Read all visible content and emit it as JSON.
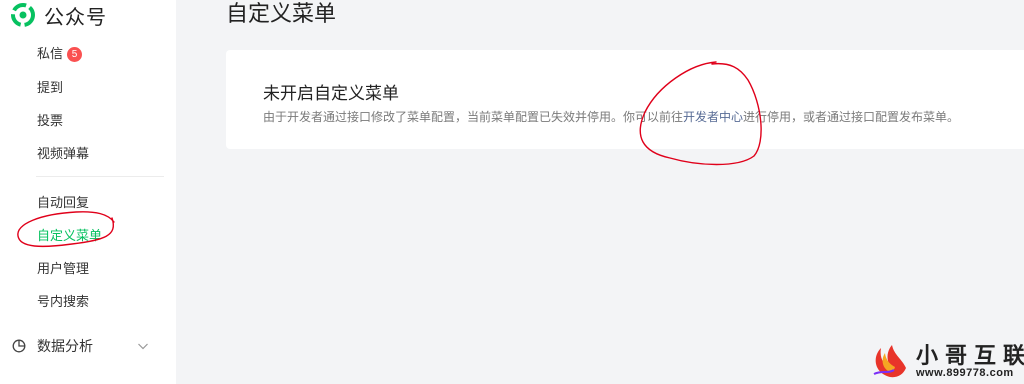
{
  "app": {
    "name": "公众号"
  },
  "sidebar": {
    "items": [
      {
        "label": "私信",
        "badge": "5"
      },
      {
        "label": "提到"
      },
      {
        "label": "投票"
      },
      {
        "label": "视频弹幕"
      },
      {
        "label": "自动回复"
      },
      {
        "label": "自定义菜单",
        "active": true
      },
      {
        "label": "用户管理"
      },
      {
        "label": "号内搜索"
      }
    ],
    "section": {
      "label": "数据分析",
      "icon": "clock-icon",
      "chevron": "chevron-down-icon"
    }
  },
  "page": {
    "title": "自定义菜单"
  },
  "card": {
    "title": "未开启自定义菜单",
    "desc_before": "由于开发者通过接口修改了菜单配置，当前菜单配置已失效并停用。你可以前往",
    "link": "开发者中心",
    "desc_after": "进行停用，或者通过接口配置发布菜单。"
  },
  "watermark": {
    "title": "小哥互联",
    "url": "www.899778.com"
  },
  "colors": {
    "accent": "#07c160",
    "badge": "#fa5151",
    "link": "#576b95",
    "annotation": "#e0001a"
  }
}
